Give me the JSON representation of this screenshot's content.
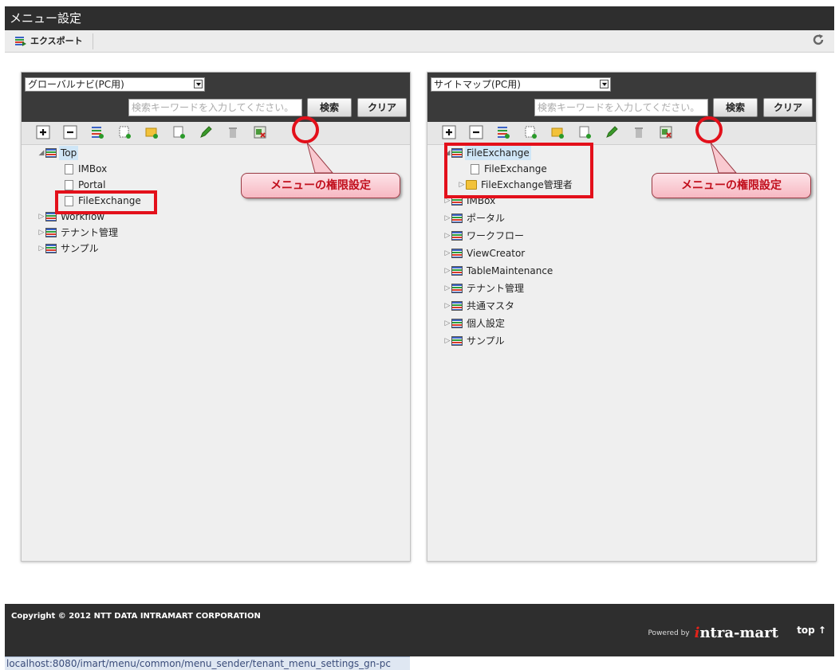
{
  "window": {
    "title": "メニュー設定"
  },
  "toolbar": {
    "export_label": "エクスポート"
  },
  "left_panel": {
    "select_value": "グローバルナビ(PC用)",
    "search_placeholder": "検索キーワードを入力してください。",
    "search_label": "検索",
    "clear_label": "クリア",
    "tree": {
      "root": "Top",
      "children": [
        "IMBox",
        "Portal",
        "FileExchange"
      ],
      "siblings": [
        "Workflow",
        "テナント管理",
        "サンプル"
      ]
    },
    "callout": "メニューの権限設定"
  },
  "right_panel": {
    "select_value": "サイトマップ(PC用)",
    "search_placeholder": "検索キーワードを入力してください。",
    "search_label": "検索",
    "clear_label": "クリア",
    "tree": {
      "root": "FileExchange",
      "children": [
        "FileExchange",
        "FileExchange管理者"
      ],
      "siblings": [
        "IMBox",
        "ポータル",
        "ワークフロー",
        "ViewCreator",
        "TableMaintenance",
        "テナント管理",
        "共通マスタ",
        "個人設定",
        "サンプル"
      ]
    },
    "callout": "メニューの権限設定"
  },
  "footer": {
    "copyright": "Copyright © 2012 NTT DATA INTRAMART CORPORATION",
    "powered_by": "Powered by",
    "brand_i": "i",
    "brand_rest": "ntra-mart",
    "top_link": "top ↑"
  },
  "statusbar": {
    "url": "localhost:8080/imart/menu/common/menu_sender/tenant_menu_settings_gn-pc"
  }
}
